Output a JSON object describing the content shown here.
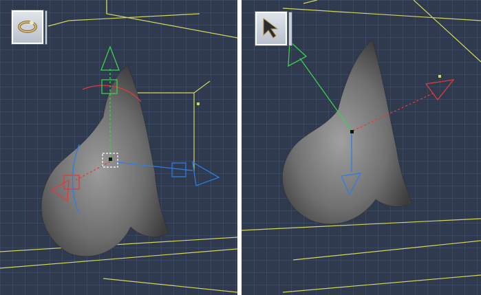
{
  "panels": [
    {
      "id": "left",
      "active_tool": "rotate-tool",
      "gizmo": "rotate-translate-gizmo"
    },
    {
      "id": "right",
      "active_tool": "select-tool",
      "gizmo": "translate-gizmo"
    }
  ],
  "colors": {
    "background": "#2f3a4f",
    "grid_line": "#4a5877",
    "bounding_box": "#d6d65a",
    "mesh_light": "#a8a8a8",
    "mesh_dark": "#3a3a3a",
    "axis_x": "#e03a3a",
    "axis_y": "#3ad24a",
    "axis_z": "#2f7de0"
  }
}
